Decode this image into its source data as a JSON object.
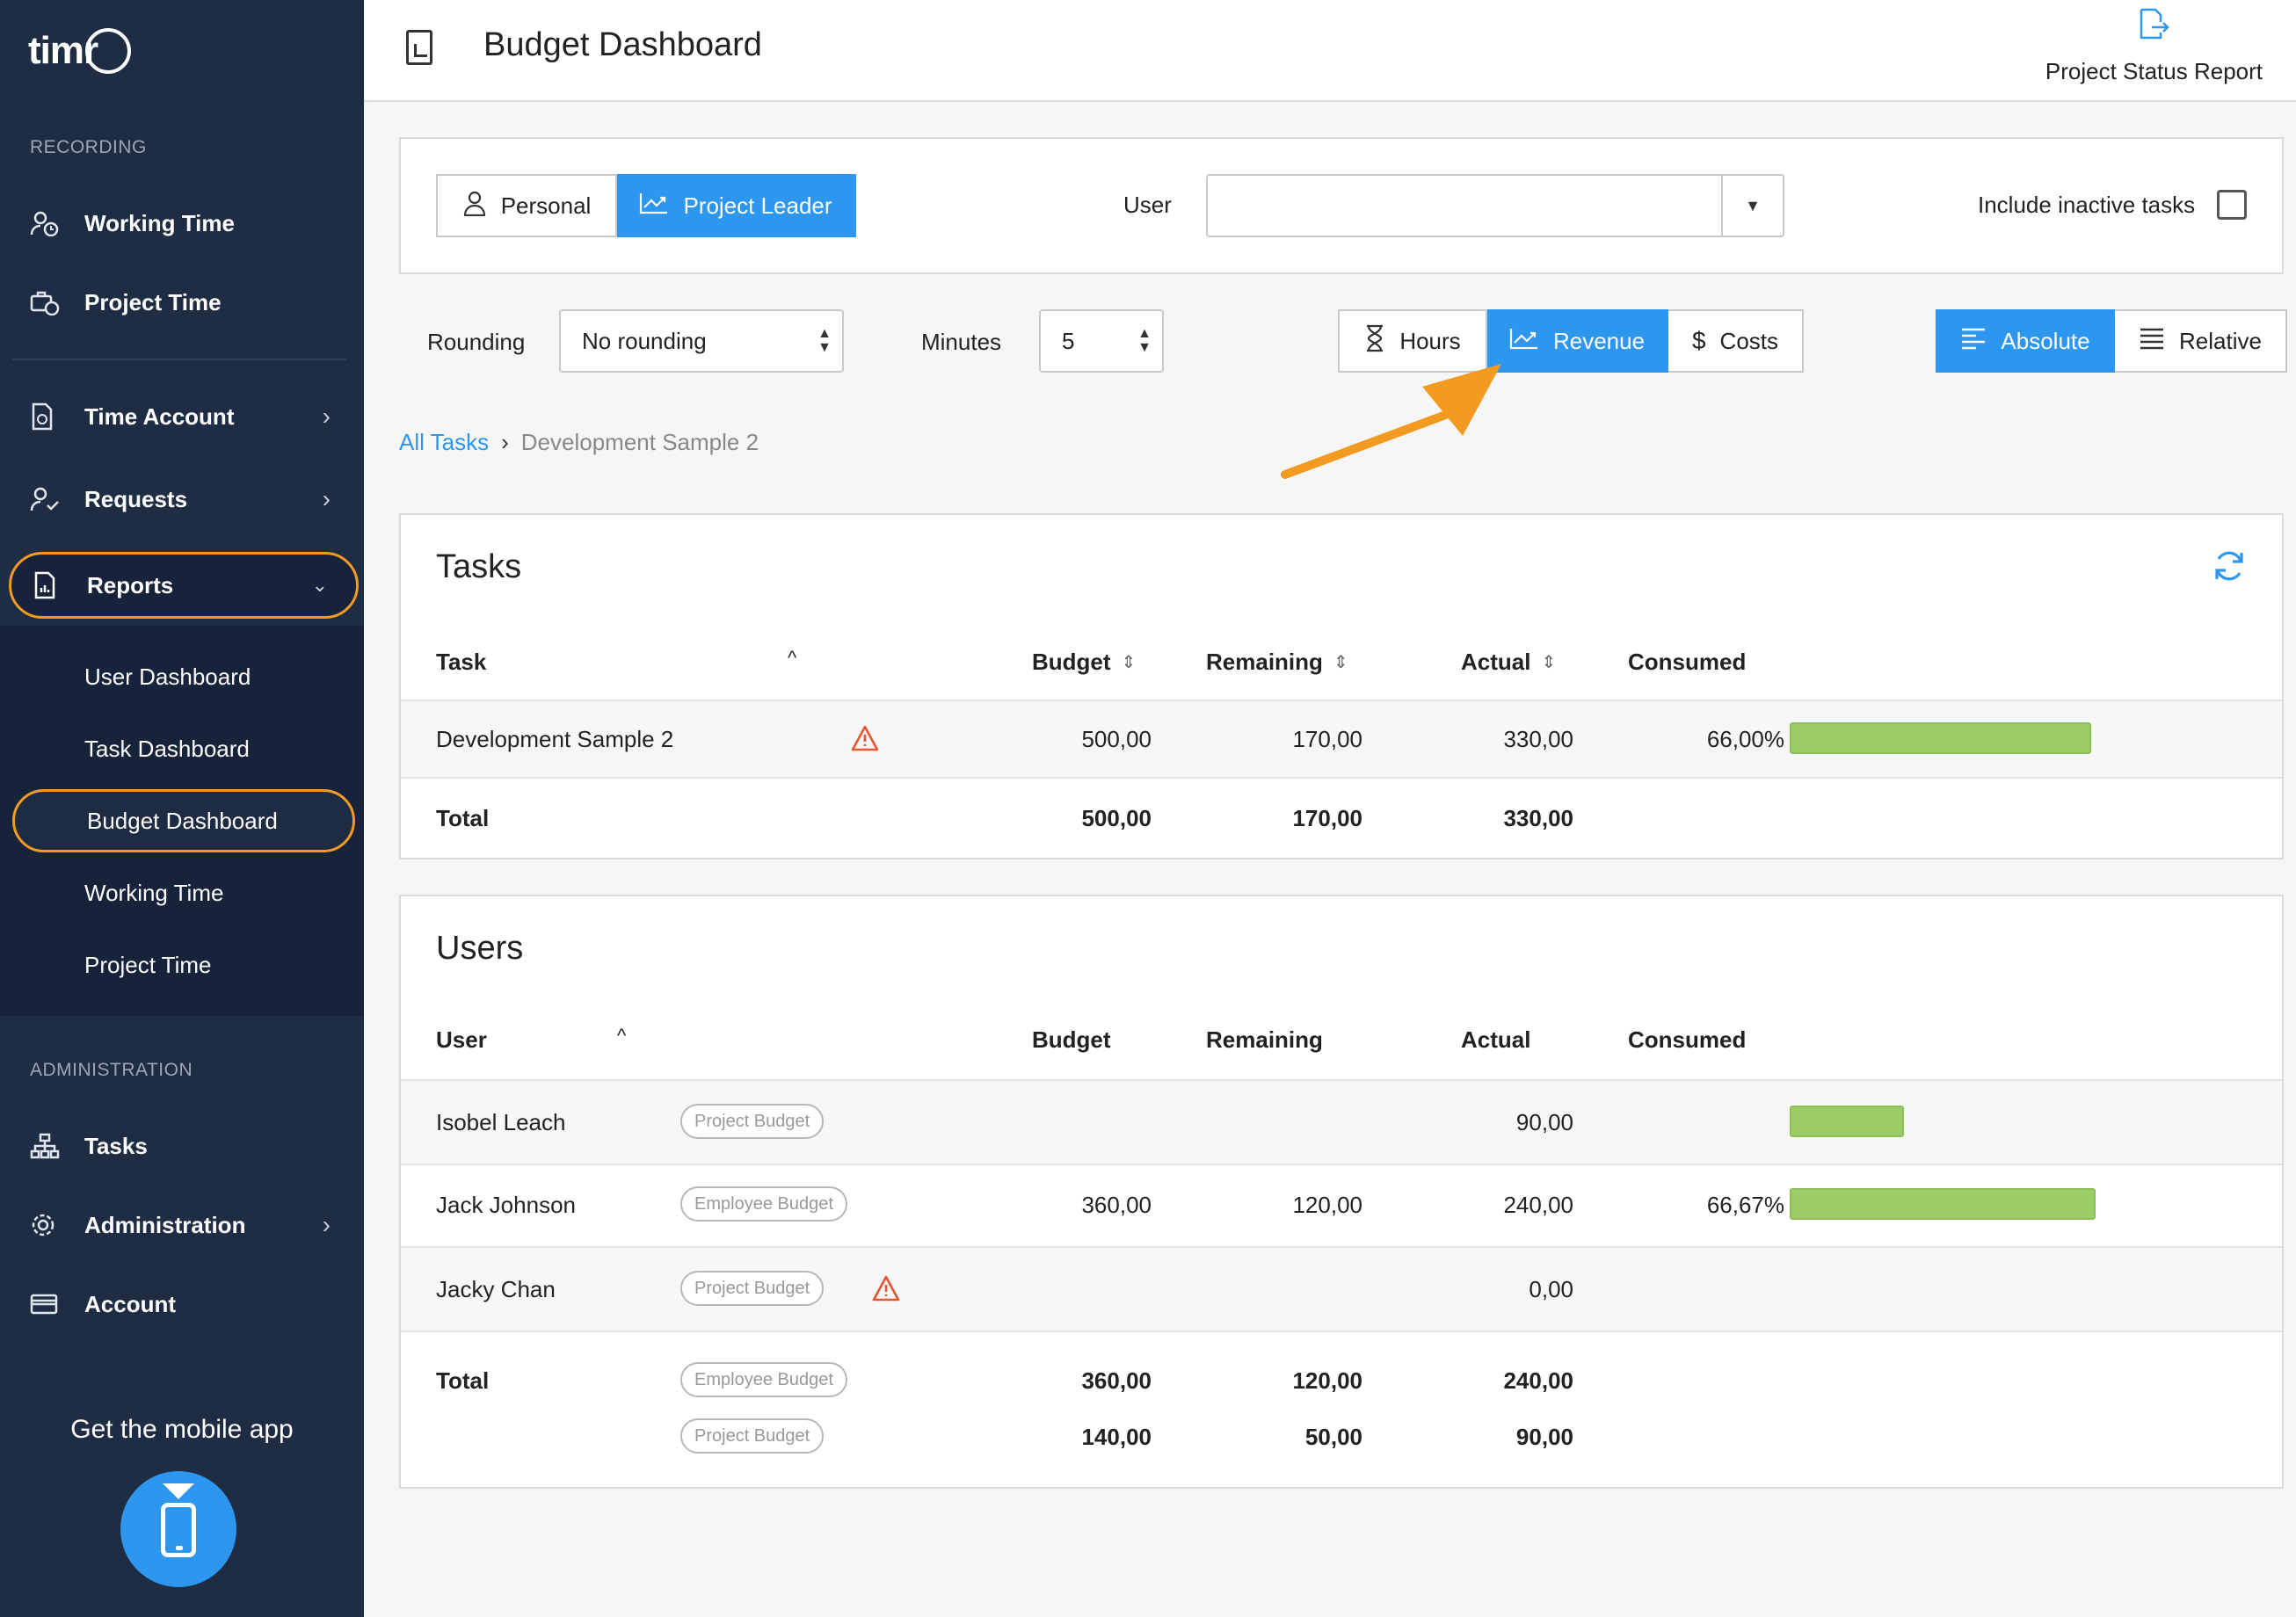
{
  "sidebar": {
    "logo": "timr",
    "recording_title": "RECORDING",
    "items": [
      {
        "label": "Working Time"
      },
      {
        "label": "Project Time"
      },
      {
        "label": "Time Account"
      },
      {
        "label": "Requests"
      },
      {
        "label": "Reports"
      }
    ],
    "reports_sub": [
      {
        "label": "User Dashboard"
      },
      {
        "label": "Task Dashboard"
      },
      {
        "label": "Budget Dashboard"
      },
      {
        "label": "Working Time"
      },
      {
        "label": "Project Time"
      }
    ],
    "admin_title": "ADMINISTRATION",
    "admin_items": [
      {
        "label": "Tasks"
      },
      {
        "label": "Administration"
      },
      {
        "label": "Account"
      }
    ],
    "mobile_app": "Get the mobile app"
  },
  "header": {
    "title": "Budget Dashboard",
    "status_report": "Project Status Report"
  },
  "filters": {
    "personal": "Personal",
    "project_leader": "Project Leader",
    "user_label": "User",
    "user_value": "",
    "include_inactive": "Include inactive tasks",
    "rounding_label": "Rounding",
    "rounding_value": "No rounding",
    "minutes_label": "Minutes",
    "minutes_value": "5",
    "hours": "Hours",
    "revenue": "Revenue",
    "costs": "Costs",
    "absolute": "Absolute",
    "relative": "Relative"
  },
  "breadcrumb": {
    "root": "All Tasks",
    "separator": "›",
    "current": "Development Sample 2"
  },
  "tasks": {
    "title": "Tasks",
    "columns": [
      "Task",
      "Budget",
      "Remaining",
      "Actual",
      "Consumed"
    ],
    "rows": [
      {
        "task": "Development Sample 2",
        "budget": "500,00",
        "remaining": "170,00",
        "actual": "330,00",
        "consumed": "66,00%",
        "consumed_fraction": 0.66
      }
    ],
    "total": {
      "label": "Total",
      "budget": "500,00",
      "remaining": "170,00",
      "actual": "330,00"
    }
  },
  "users": {
    "title": "Users",
    "columns": [
      "User",
      "Budget",
      "Remaining",
      "Actual",
      "Consumed"
    ],
    "rows": [
      {
        "user": "Isobel Leach",
        "tag": "Project Budget",
        "budget": "",
        "remaining": "",
        "actual": "90,00",
        "consumed": ""
      },
      {
        "user": "Jack Johnson",
        "tag": "Employee Budget",
        "budget": "360,00",
        "remaining": "120,00",
        "actual": "240,00",
        "consumed": "66,67%"
      },
      {
        "user": "Jacky Chan",
        "tag": "Project Budget",
        "budget": "",
        "remaining": "",
        "actual": "0,00",
        "consumed": ""
      }
    ],
    "total": {
      "label": "Total",
      "employee": {
        "tag": "Employee Budget",
        "budget": "360,00",
        "remaining": "120,00",
        "actual": "240,00"
      },
      "project": {
        "tag": "Project Budget",
        "budget": "140,00",
        "remaining": "50,00",
        "actual": "90,00"
      }
    }
  },
  "colors": {
    "accent": "#2d96ef",
    "sidebar": "#1f2d44",
    "highlight": "#f39a21",
    "bar": "#9ccc65",
    "warning": "#e8542b"
  }
}
